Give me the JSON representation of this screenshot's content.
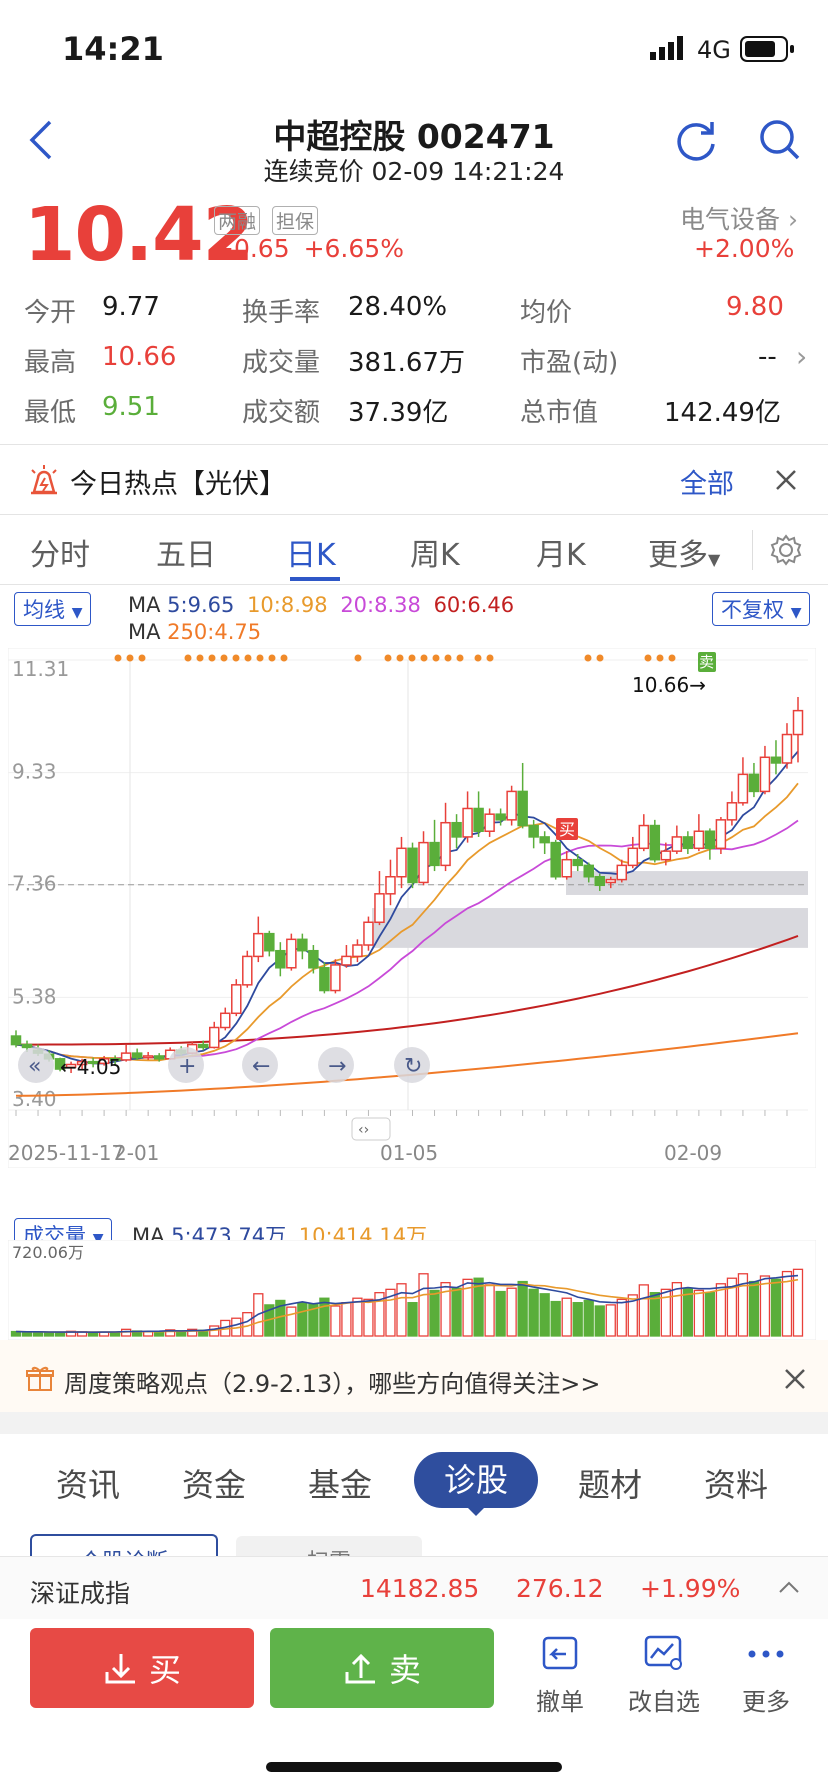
{
  "status": {
    "time": "14:21",
    "network": "4G"
  },
  "header": {
    "title": "中超控股 002471",
    "subtitle": "连续竞价 02-09 14:21:24"
  },
  "quote": {
    "price": "10.42",
    "tag1": "两融",
    "tag2": "担保",
    "change": "+0.65",
    "change_pct": "+6.65%",
    "industry": "电气设备",
    "industry_chg": "+2.00%",
    "rows": [
      [
        {
          "l": "今开",
          "v": "9.77"
        },
        {
          "l": "换手率",
          "v": "28.40%"
        },
        {
          "l": "均价",
          "v": "9.80"
        }
      ],
      [
        {
          "l": "最高",
          "v": "10.66"
        },
        {
          "l": "成交量",
          "v": "381.67万"
        },
        {
          "l": "市盈(动)",
          "v": "--"
        }
      ],
      [
        {
          "l": "最低",
          "v": "9.51"
        },
        {
          "l": "成交额",
          "v": "37.39亿"
        },
        {
          "l": "总市值",
          "v": "142.49亿"
        }
      ]
    ]
  },
  "hot": {
    "text": "今日热点【光伏】",
    "all": "全部"
  },
  "ktabs": [
    "分时",
    "五日",
    "日K",
    "周K",
    "月K",
    "更多"
  ],
  "ma_legend": {
    "selector": "均线",
    "prefix": "MA",
    "ma5": "5:9.65",
    "ma10": "10:8.98",
    "ma20": "20:8.38",
    "ma60": "60:6.46",
    "ma250": "250:4.75",
    "adjust": "不复权"
  },
  "chart_data": [
    {
      "type": "candlestick",
      "yticks": [
        "11.31",
        "9.33",
        "7.36",
        "5.38",
        "3.40"
      ],
      "xlabels": [
        "2025-11-17",
        "2-01",
        "01-05",
        "02-09"
      ],
      "high_label": "10.66",
      "low_label": "4.05",
      "buy_label": "买",
      "sell_label": "卖",
      "ylim": [
        3.4,
        11.31
      ],
      "candles": [
        [
          4.7,
          4.55,
          4.8,
          4.5
        ],
        [
          4.55,
          4.5,
          4.62,
          4.42
        ],
        [
          4.45,
          4.4,
          4.55,
          4.35
        ],
        [
          4.38,
          4.3,
          4.45,
          4.25
        ],
        [
          4.3,
          4.12,
          4.32,
          4.08
        ],
        [
          4.15,
          4.2,
          4.25,
          4.05
        ],
        [
          4.2,
          4.25,
          4.3,
          4.12
        ],
        [
          4.25,
          4.22,
          4.32,
          4.15
        ],
        [
          4.22,
          4.3,
          4.35,
          4.18
        ],
        [
          4.3,
          4.28,
          4.36,
          4.2
        ],
        [
          4.28,
          4.4,
          4.55,
          4.25
        ],
        [
          4.4,
          4.32,
          4.48,
          4.28
        ],
        [
          4.32,
          4.35,
          4.42,
          4.28
        ],
        [
          4.35,
          4.3,
          4.4,
          4.25
        ],
        [
          4.3,
          4.45,
          4.5,
          4.28
        ],
        [
          4.45,
          4.4,
          4.52,
          4.35
        ],
        [
          4.4,
          4.55,
          4.6,
          4.38
        ],
        [
          4.55,
          4.5,
          4.62,
          4.45
        ],
        [
          4.5,
          4.85,
          4.95,
          4.48
        ],
        [
          4.85,
          5.1,
          5.2,
          4.8
        ],
        [
          5.1,
          5.6,
          5.7,
          5.05
        ],
        [
          5.6,
          6.1,
          6.2,
          5.55
        ],
        [
          6.1,
          6.5,
          6.8,
          6.0
        ],
        [
          6.5,
          6.2,
          6.55,
          6.1
        ],
        [
          6.2,
          5.9,
          6.35,
          5.75
        ],
        [
          5.9,
          6.4,
          6.5,
          5.85
        ],
        [
          6.4,
          6.2,
          6.5,
          6.05
        ],
        [
          6.2,
          5.9,
          6.3,
          5.8
        ],
        [
          5.9,
          5.5,
          6.0,
          5.45
        ],
        [
          5.5,
          5.95,
          6.05,
          5.45
        ],
        [
          5.95,
          6.1,
          6.3,
          5.9
        ],
        [
          6.1,
          6.3,
          6.4,
          6.0
        ],
        [
          6.3,
          6.7,
          6.8,
          6.2
        ],
        [
          6.7,
          7.2,
          7.6,
          6.65
        ],
        [
          7.2,
          7.5,
          7.8,
          7.0
        ],
        [
          7.5,
          8.0,
          8.2,
          7.3
        ],
        [
          8.0,
          7.4,
          8.1,
          7.3
        ],
        [
          7.4,
          8.1,
          8.3,
          7.35
        ],
        [
          8.1,
          7.7,
          8.5,
          7.6
        ],
        [
          7.7,
          8.45,
          8.8,
          7.6
        ],
        [
          8.45,
          8.2,
          8.6,
          8.0
        ],
        [
          8.2,
          8.7,
          9.0,
          8.1
        ],
        [
          8.7,
          8.3,
          9.0,
          8.2
        ],
        [
          8.3,
          8.6,
          8.7,
          8.2
        ],
        [
          8.6,
          8.5,
          8.7,
          8.4
        ],
        [
          8.5,
          9.0,
          9.1,
          8.4
        ],
        [
          9.0,
          8.4,
          9.5,
          8.35
        ],
        [
          8.4,
          8.2,
          8.5,
          8.0
        ],
        [
          8.2,
          8.1,
          8.3,
          7.9
        ],
        [
          8.1,
          7.5,
          8.15,
          7.45
        ],
        [
          7.5,
          7.8,
          7.95,
          7.45
        ],
        [
          7.8,
          7.7,
          7.9,
          7.6
        ],
        [
          7.7,
          7.5,
          7.75,
          7.4
        ],
        [
          7.5,
          7.35,
          7.55,
          7.25
        ],
        [
          7.4,
          7.45,
          7.5,
          7.3
        ],
        [
          7.45,
          7.7,
          7.8,
          7.4
        ],
        [
          7.7,
          8.0,
          8.2,
          7.65
        ],
        [
          8.0,
          8.4,
          8.6,
          7.95
        ],
        [
          8.4,
          7.8,
          8.5,
          7.75
        ],
        [
          7.8,
          7.95,
          8.1,
          7.7
        ],
        [
          7.95,
          8.2,
          8.4,
          7.9
        ],
        [
          8.2,
          8.0,
          8.3,
          7.9
        ],
        [
          8.0,
          8.3,
          8.6,
          7.95
        ],
        [
          8.3,
          8.0,
          8.35,
          7.8
        ],
        [
          8.0,
          8.5,
          8.55,
          7.9
        ],
        [
          8.5,
          8.8,
          9.0,
          8.4
        ],
        [
          8.8,
          9.3,
          9.6,
          8.75
        ],
        [
          9.3,
          9.0,
          9.5,
          8.9
        ],
        [
          9.0,
          9.6,
          9.8,
          8.95
        ],
        [
          9.6,
          9.5,
          9.9,
          9.3
        ],
        [
          9.5,
          10.0,
          10.2,
          9.4
        ],
        [
          10.0,
          10.42,
          10.66,
          9.51
        ]
      ],
      "ma5_end": 9.65,
      "ma10_end": 8.98,
      "ma20_end": 8.38,
      "ma60_end": 6.46,
      "ma250_end": 4.75
    },
    {
      "type": "bar",
      "title": "成交量",
      "ma5": "5:473.74万",
      "ma10": "10:414.14万",
      "ymax_label": "720.06万",
      "ylim": [
        0,
        720.06
      ],
      "values": [
        40,
        35,
        38,
        30,
        32,
        42,
        38,
        30,
        35,
        33,
        60,
        45,
        40,
        38,
        55,
        48,
        60,
        52,
        90,
        140,
        160,
        210,
        380,
        280,
        320,
        260,
        300,
        290,
        340,
        270,
        300,
        340,
        330,
        390,
        420,
        470,
        300,
        560,
        410,
        480,
        430,
        510,
        520,
        460,
        400,
        430,
        490,
        420,
        380,
        310,
        340,
        300,
        320,
        270,
        280,
        330,
        370,
        460,
        390,
        420,
        480,
        430,
        410,
        390,
        470,
        520,
        560,
        490,
        540,
        510,
        580,
        600
      ]
    }
  ],
  "news": {
    "text": "周度策略观点（2.9-2.13），哪些方向值得关注>>"
  },
  "btabs": [
    "资讯",
    "资金",
    "基金",
    "诊股",
    "题材",
    "资料"
  ],
  "subtabs": [
    "个股诊断",
    "扫雷"
  ],
  "index": {
    "name": "深证成指",
    "value": "14182.85",
    "change": "276.12",
    "pct": "+1.99%"
  },
  "actions": {
    "buy": "买",
    "sell": "卖",
    "cancel": "撤单",
    "edit_watch": "改自选",
    "more": "更多"
  }
}
